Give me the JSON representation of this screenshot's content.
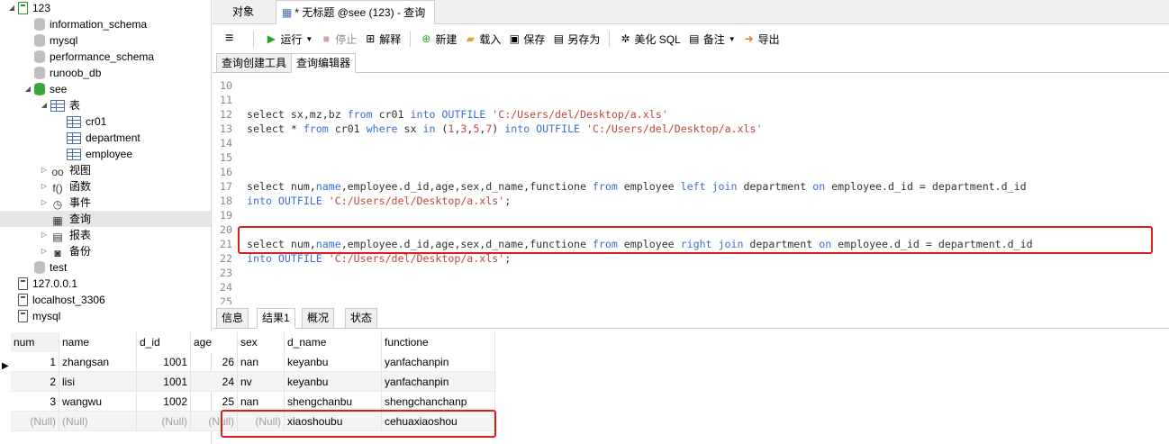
{
  "tree": {
    "items": [
      {
        "label": "123",
        "depth": 0,
        "arrow": "◢",
        "icon": "connection-icon",
        "green": true
      },
      {
        "label": "information_schema",
        "depth": 1,
        "arrow": "",
        "icon": "database-icon"
      },
      {
        "label": "mysql",
        "depth": 1,
        "arrow": "",
        "icon": "database-icon"
      },
      {
        "label": "performance_schema",
        "depth": 1,
        "arrow": "",
        "icon": "database-icon"
      },
      {
        "label": "runoob_db",
        "depth": 1,
        "arrow": "",
        "icon": "database-icon"
      },
      {
        "label": "see",
        "depth": 1,
        "arrow": "◢",
        "icon": "database-icon",
        "green": true
      },
      {
        "label": "表",
        "depth": 2,
        "arrow": "◢",
        "icon": "table-icon"
      },
      {
        "label": "cr01",
        "depth": 3,
        "arrow": "",
        "icon": "table-icon"
      },
      {
        "label": "department",
        "depth": 3,
        "arrow": "",
        "icon": "table-icon"
      },
      {
        "label": "employee",
        "depth": 3,
        "arrow": "",
        "icon": "table-icon"
      },
      {
        "label": "视图",
        "depth": 2,
        "arrow": "▷",
        "icon": "view-icon",
        "glyph": "oo"
      },
      {
        "label": "函数",
        "depth": 2,
        "arrow": "▷",
        "icon": "function-icon",
        "glyph": "f()"
      },
      {
        "label": "事件",
        "depth": 2,
        "arrow": "▷",
        "icon": "event-icon",
        "glyph": "◷"
      },
      {
        "label": "查询",
        "depth": 2,
        "arrow": "",
        "icon": "query-icon",
        "glyph": "▦",
        "selected": true
      },
      {
        "label": "报表",
        "depth": 2,
        "arrow": "▷",
        "icon": "report-icon",
        "glyph": "▤"
      },
      {
        "label": "备份",
        "depth": 2,
        "arrow": "▷",
        "icon": "backup-icon",
        "glyph": "◙"
      },
      {
        "label": "test",
        "depth": 1,
        "arrow": "",
        "icon": "database-icon"
      },
      {
        "label": "127.0.0.1",
        "depth": 0,
        "arrow": "",
        "icon": "connection-icon"
      },
      {
        "label": "localhost_3306",
        "depth": 0,
        "arrow": "",
        "icon": "connection-icon"
      },
      {
        "label": "mysql",
        "depth": 0,
        "arrow": "",
        "icon": "connection-icon"
      }
    ]
  },
  "doc_tabs": {
    "objects": "对象",
    "query": "* 无标题 @see (123) - 查询"
  },
  "toolbar": {
    "menu": "≡",
    "run": "运行",
    "stop": "停止",
    "explain": "解释",
    "new": "新建",
    "load": "载入",
    "save": "保存",
    "save_as": "另存为",
    "beautify": "美化 SQL",
    "comment": "备注",
    "export": "导出"
  },
  "sub_tabs": {
    "builder": "查询创建工具",
    "editor": "查询编辑器"
  },
  "editor": {
    "lines": [
      {
        "n": "10",
        "tokens": []
      },
      {
        "n": "11",
        "tokens": []
      },
      {
        "n": "12",
        "tokens": [
          [
            "c",
            "select sx,mz,bz "
          ],
          [
            "k",
            "from"
          ],
          [
            "c",
            " cr01 "
          ],
          [
            "k",
            "into OUTFILE"
          ],
          [
            "c",
            " "
          ],
          [
            "s",
            "'C:/Users/del/Desktop/a.xls'"
          ]
        ]
      },
      {
        "n": "13",
        "tokens": [
          [
            "c",
            "select * "
          ],
          [
            "k",
            "from"
          ],
          [
            "c",
            " cr01 "
          ],
          [
            "k",
            "where"
          ],
          [
            "c",
            " sx "
          ],
          [
            "k",
            "in"
          ],
          [
            "c",
            " ("
          ],
          [
            "s",
            "1"
          ],
          [
            "c",
            ","
          ],
          [
            "s",
            "3"
          ],
          [
            "c",
            ","
          ],
          [
            "s",
            "5"
          ],
          [
            "c",
            ","
          ],
          [
            "s",
            "7"
          ],
          [
            "c",
            ") "
          ],
          [
            "k",
            "into OUTFILE"
          ],
          [
            "c",
            " "
          ],
          [
            "s",
            "'C:/Users/del/Desktop/a.xls'"
          ]
        ]
      },
      {
        "n": "14",
        "tokens": []
      },
      {
        "n": "15",
        "tokens": []
      },
      {
        "n": "16",
        "tokens": []
      },
      {
        "n": "17",
        "tokens": [
          [
            "c",
            "select num,"
          ],
          [
            "k",
            "name"
          ],
          [
            "c",
            ",employee.d_id,age,sex,d_name,functione "
          ],
          [
            "k",
            "from"
          ],
          [
            "c",
            " employee "
          ],
          [
            "k",
            "left join"
          ],
          [
            "c",
            " department "
          ],
          [
            "k",
            "on"
          ],
          [
            "c",
            " employee.d_id = department.d_id"
          ]
        ]
      },
      {
        "n": "18",
        "tokens": [
          [
            "k",
            "into OUTFILE"
          ],
          [
            "c",
            " "
          ],
          [
            "s",
            "'C:/Users/del/Desktop/a.xls'"
          ],
          [
            "c",
            ";"
          ]
        ]
      },
      {
        "n": "19",
        "tokens": []
      },
      {
        "n": "20",
        "tokens": []
      },
      {
        "n": "21",
        "tokens": [
          [
            "c",
            "select num,"
          ],
          [
            "k",
            "name"
          ],
          [
            "c",
            ",employee.d_id,age,sex,d_name,functione "
          ],
          [
            "k",
            "from"
          ],
          [
            "c",
            " employee "
          ],
          [
            "k",
            "right join"
          ],
          [
            "c",
            " department "
          ],
          [
            "k",
            "on"
          ],
          [
            "c",
            " employee.d_id = department.d_id"
          ]
        ]
      },
      {
        "n": "22",
        "tokens": [
          [
            "k",
            "into OUTFILE"
          ],
          [
            "c",
            " "
          ],
          [
            "s",
            "'C:/Users/del/Desktop/a.xls'"
          ],
          [
            "c",
            ";"
          ]
        ]
      },
      {
        "n": "23",
        "tokens": []
      },
      {
        "n": "24",
        "tokens": []
      },
      {
        "n": "25",
        "tokens": []
      }
    ]
  },
  "result_tabs": {
    "info": "信息",
    "result1": "结果1",
    "profile": "概况",
    "status": "状态"
  },
  "grid": {
    "columns": [
      "num",
      "name",
      "d_id",
      "age",
      "sex",
      "d_name",
      "functione"
    ],
    "rows": [
      [
        "1",
        "zhangsan",
        "1001",
        "26",
        "nan",
        "keyanbu",
        "yanfachanpin"
      ],
      [
        "2",
        "lisi",
        "1001",
        "24",
        "nv",
        "keyanbu",
        "yanfachanpin"
      ],
      [
        "3",
        "wangwu",
        "1002",
        "25",
        "nan",
        "shengchanbu",
        "shengchanchanp"
      ],
      [
        "(Null)",
        "(Null)",
        "(Null)",
        "(Null)",
        "(Null)",
        "xiaoshoubu",
        "cehuaxiaoshou"
      ]
    ],
    "current_row_marker": "▶"
  },
  "colors": {
    "highlight_box": "#e11b1b",
    "keyword": "#3b6ed6",
    "string": "#c0463c"
  }
}
